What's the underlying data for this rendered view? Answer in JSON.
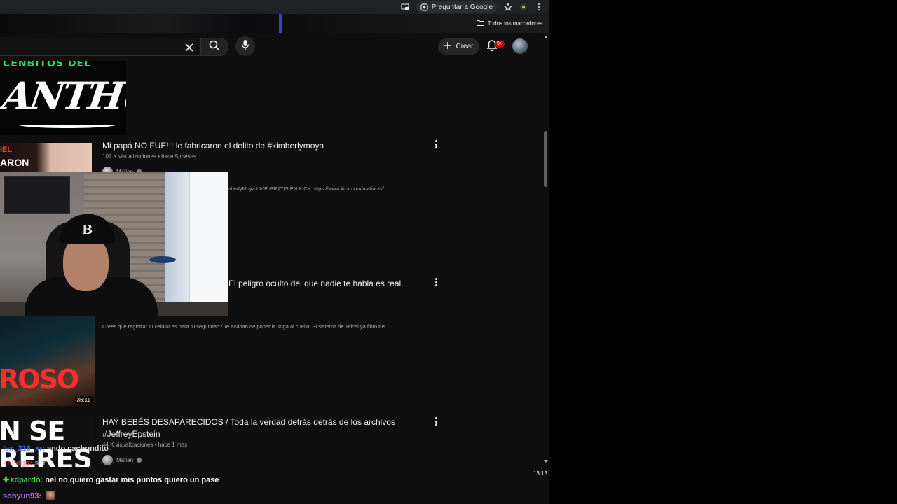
{
  "browser": {
    "ask_google_label": "Preguntar a Google",
    "bookmarks_all_label": "Todos los marcadores"
  },
  "header": {
    "create_label": "Crear",
    "notification_badge": "9+"
  },
  "thumbnails": {
    "anthua_top_text": "CENBITOS DEL",
    "anthua_text": "ANTHUÁ",
    "v1_tag": "IEL",
    "v1_tag2": "ARON",
    "v3_text": "ROSO",
    "v4_text_line1": "N SE",
    "v4_text_line2": "RERES"
  },
  "results": [
    {
      "title": "Mi papá NO FUE!!! le fabricaron el delito de #kimberlymoya",
      "meta": "107 K visualizaciones • hace 5 meses",
      "channel": "Mafian",
      "description": "mberlyMoya LIVE GRATIS EN KICK https://www.kick.com/mafiantv/ ..."
    },
    {
      "title": "El peligro oculto del que nadie te habla es real",
      "description": "Crees que registrar tu celular es para tu seguridad? Te acaban de poner la soga al cuello. El sistema de Telcel ya filtró tus ...",
      "duration": "36:11"
    },
    {
      "title": "HAY BEBÉS DESAPARECIDOS / Toda la verdad detrás detrás de los archivos #JeffreyEpstein",
      "meta": "44 K visualizaciones • hace 1 mes",
      "channel": "Mafian"
    }
  ],
  "stream": {
    "timestamp": "13:13",
    "chat": [
      {
        "user": "lex_216_xr:",
        "message": "ando cachondito"
      },
      {
        "user": "kmlagg:",
        "message": "ssr"
      },
      {
        "user": "kdpardo:",
        "message": "nel no quiero gastar mis puntos quiero un pase"
      },
      {
        "user": "sohyun93:",
        "message": ""
      }
    ]
  },
  "colors": {
    "youtube_bg": "#0f0f0f",
    "chrome_bg": "#202124",
    "notification_red": "#cc0000",
    "chat_green": "#5bdc5b",
    "chat_purple": "#b86bff"
  }
}
